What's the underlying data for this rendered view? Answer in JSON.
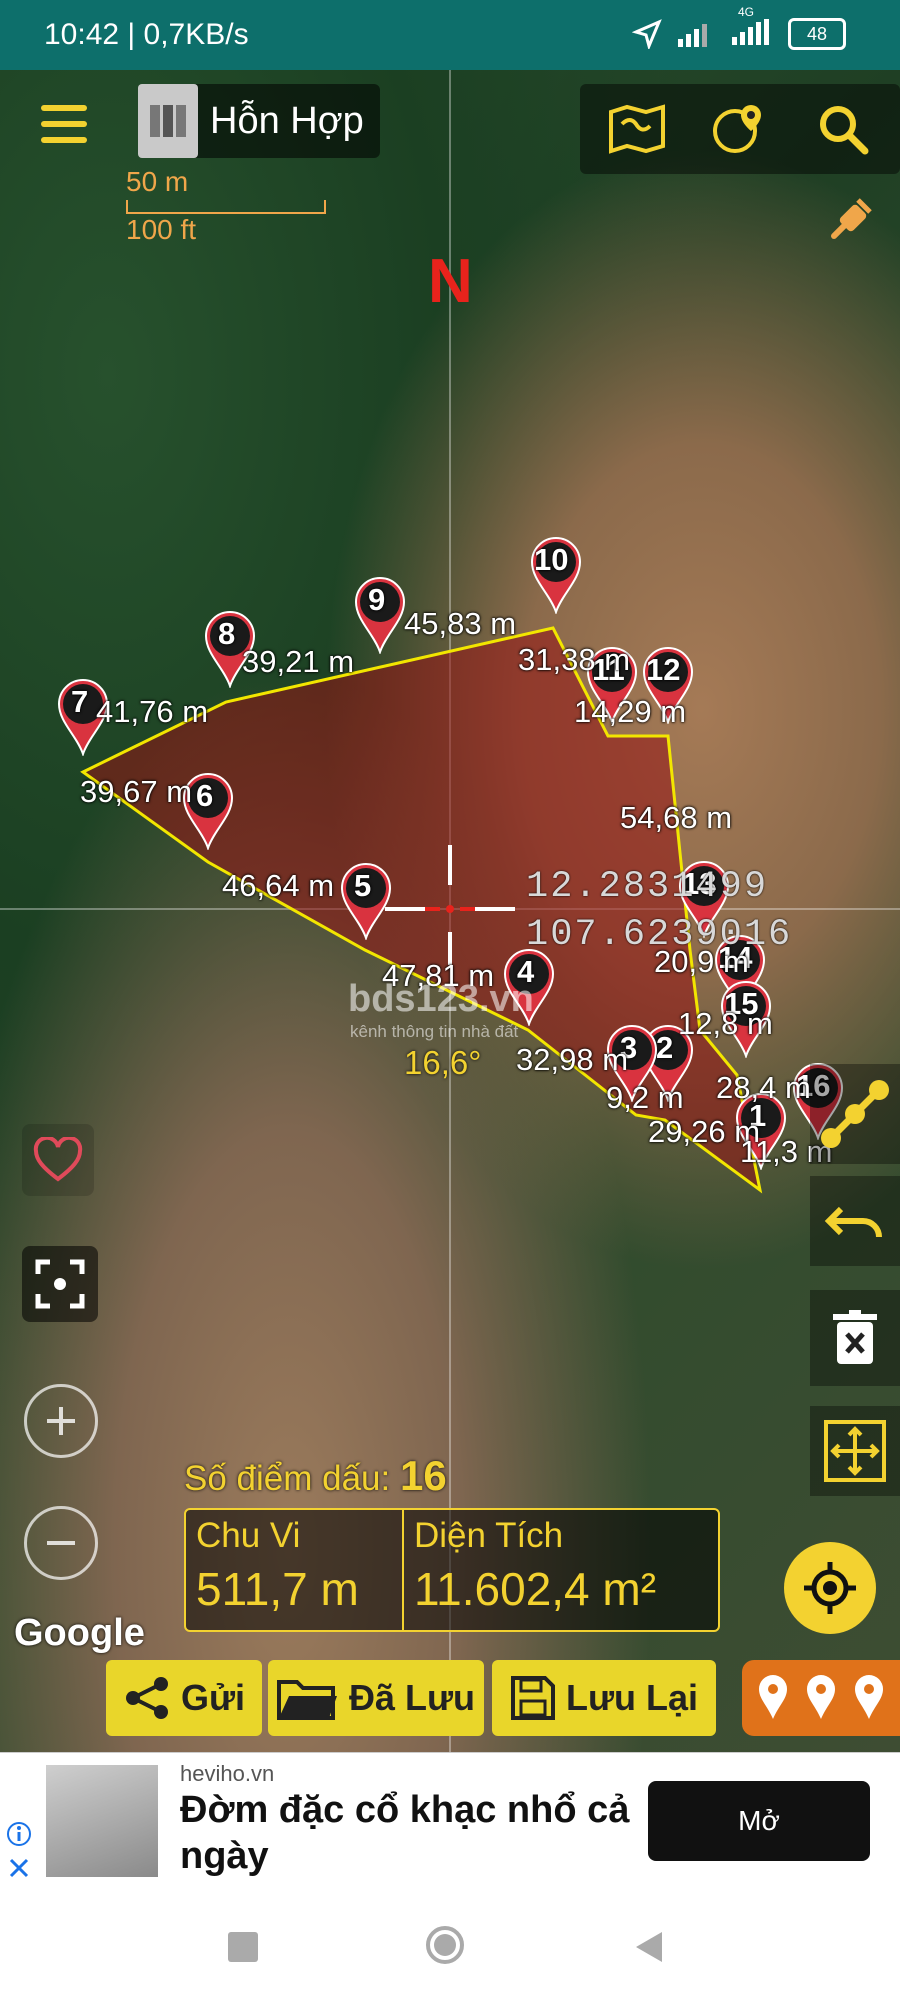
{
  "status_bar": {
    "time": "10:42 | 0,7KB/s",
    "network": "4G",
    "battery": "48"
  },
  "toolbar": {
    "map_type_label": "Hỗn Hợp",
    "icons": [
      "menu-icon",
      "map-layers-icon",
      "place-pin-globe-icon",
      "search-icon",
      "gps-off-icon"
    ]
  },
  "scale": {
    "metric": "50 m",
    "imperial": "100 ft"
  },
  "north_label": "N",
  "points": [
    "1",
    "2",
    "3",
    "4",
    "5",
    "6",
    "7",
    "8",
    "9",
    "10",
    "11",
    "12",
    "13",
    "14",
    "15",
    "16"
  ],
  "segments": [
    "29,26 m",
    "9,2 m",
    "32,98 m",
    "47,81 m",
    "46,64 m",
    "39,67 m",
    "41,76 m",
    "39,21 m",
    "45,83 m",
    "31,38 m",
    "14,29 m",
    "54,68 m",
    "20,9 m",
    "12,8 m",
    "28,4 m",
    "11,3 m"
  ],
  "crosshair": {
    "lat": "12.2831499",
    "lng": "107.6239016"
  },
  "angle": "16,6°",
  "watermark": {
    "brand": "bds123.vn",
    "tagline": "kênh thông tin nhà đất"
  },
  "google_logo": "Google",
  "summary": {
    "points_label": "Số điểm dấu:",
    "points_value": "16",
    "perimeter_label": "Chu Vi",
    "perimeter_value": "511,7 m",
    "area_label": "Diện Tích",
    "area_value": "11.602,4  m²"
  },
  "actions": {
    "send": "Gửi",
    "saved": "Đã Lưu",
    "save": "Lưu Lại"
  },
  "side_icons": [
    "favorite-heart-icon",
    "center-focus-icon",
    "zoom-in-icon",
    "zoom-out-icon",
    "draw-line-icon",
    "undo-icon",
    "delete-icon",
    "fit-bounds-icon",
    "my-location-icon"
  ],
  "ad": {
    "source": "heviho.vn",
    "title": "Đờm đặc cổ khạc nhổ cả ngày",
    "cta": "Mở"
  },
  "colors": {
    "accent": "#f3d230",
    "status_bar": "#0d6f6b",
    "pin": "#d9333f",
    "polygon_stroke": "#f2e600"
  }
}
